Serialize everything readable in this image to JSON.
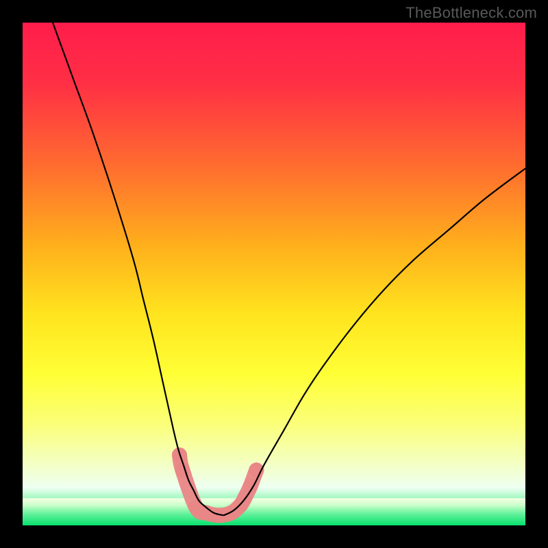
{
  "watermark": "TheBottleneck.com",
  "chart_data": {
    "type": "line",
    "title": "",
    "xlabel": "",
    "ylabel": "",
    "xlim": [
      0,
      100
    ],
    "ylim": [
      0,
      100
    ],
    "grid": false,
    "series": [
      {
        "name": "left-curve",
        "x": [
          6,
          10,
          14,
          18,
          22,
          24,
          26,
          28,
          30,
          31,
          32,
          33,
          34,
          35,
          36,
          38,
          40
        ],
        "y": [
          100,
          89,
          78,
          66,
          53,
          45,
          37,
          28,
          19,
          15,
          12,
          9,
          7,
          5,
          4,
          2.5,
          2
        ]
      },
      {
        "name": "right-curve",
        "x": [
          40,
          42,
          44,
          46,
          48,
          52,
          56,
          60,
          66,
          72,
          78,
          85,
          92,
          100
        ],
        "y": [
          2,
          3,
          5,
          8,
          12,
          19,
          26,
          32,
          40,
          47,
          53,
          59,
          65,
          71
        ]
      },
      {
        "name": "markers",
        "x": [
          31.2,
          31.8,
          34.5,
          36.5,
          39.0,
          41.5,
          43.3,
          44.2,
          45.3,
          46.5
        ],
        "y": [
          14.0,
          11.0,
          3.6,
          2.5,
          2.0,
          2.5,
          4.0,
          5.5,
          7.8,
          11.0
        ],
        "color": "#e98686",
        "marker_radius_px": 11
      }
    ],
    "green_band": {
      "y_top_pct": 1.2,
      "y_bottom_pct": 5.4
    },
    "gradient_stops": [
      {
        "offset": 0.0,
        "color": "#ff1d4b"
      },
      {
        "offset": 0.12,
        "color": "#ff2f45"
      },
      {
        "offset": 0.28,
        "color": "#ff6a30"
      },
      {
        "offset": 0.44,
        "color": "#ffae1c"
      },
      {
        "offset": 0.58,
        "color": "#ffe41e"
      },
      {
        "offset": 0.7,
        "color": "#ffff36"
      },
      {
        "offset": 0.8,
        "color": "#fbff7a"
      },
      {
        "offset": 0.88,
        "color": "#f3ffc6"
      },
      {
        "offset": 0.925,
        "color": "#eefff1"
      },
      {
        "offset": 0.96,
        "color": "#6df59f"
      },
      {
        "offset": 1.0,
        "color": "#00e06a"
      }
    ]
  }
}
